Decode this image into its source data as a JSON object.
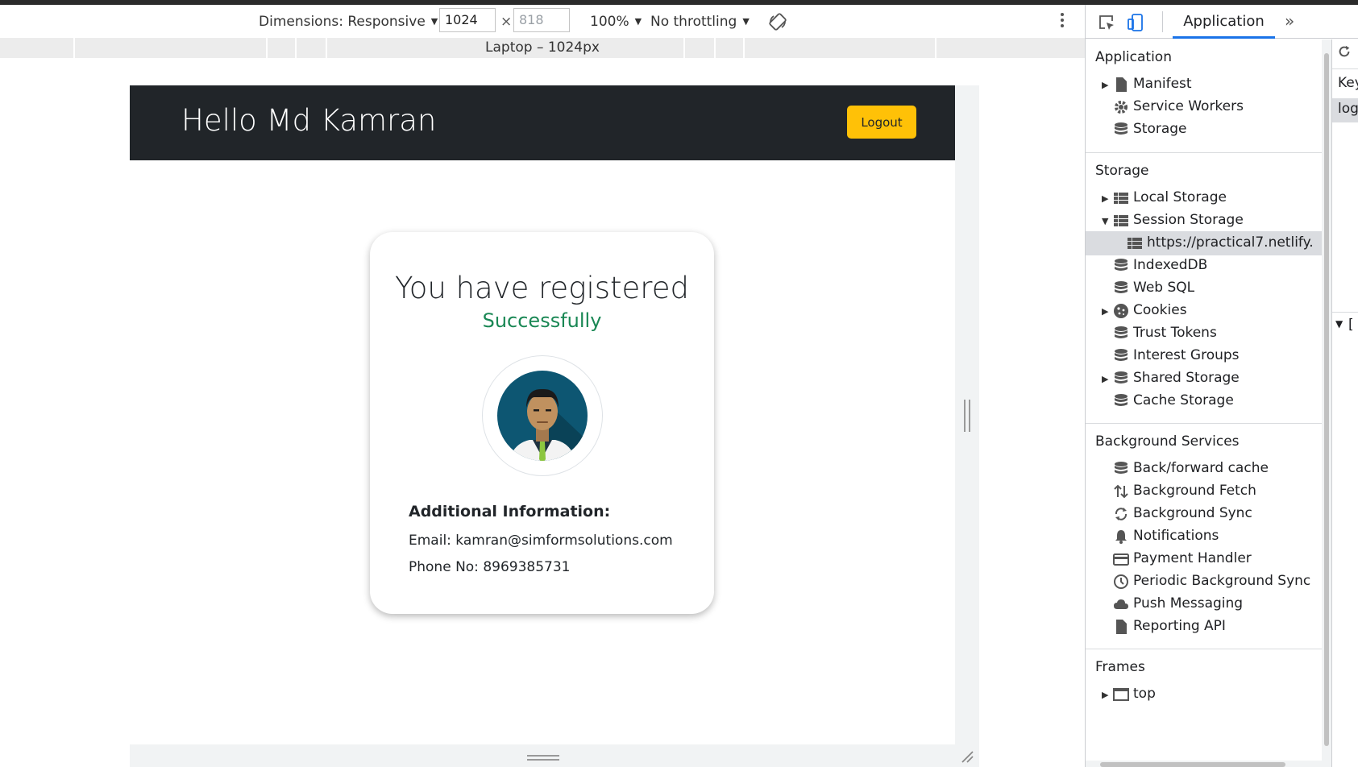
{
  "device_toolbar": {
    "dimensions_label": "Dimensions: Responsive",
    "width_value": "1024",
    "times_sign": "×",
    "height_placeholder": "818",
    "zoom_label": "100%",
    "throttling_label": "No throttling",
    "media_label": "Laptop – 1024px"
  },
  "page": {
    "nav_title": "Hello Md Kamran",
    "logout_label": "Logout",
    "card": {
      "title": "You have registered",
      "subtitle": "Successfully",
      "info_heading": "Additional Information:",
      "email_line": "Email: kamran@simformsolutions.com",
      "phone_line": "Phone No: 8969385731"
    }
  },
  "devtools": {
    "active_tab": "Application",
    "sections": {
      "application": {
        "title": "Application",
        "items": [
          "Manifest",
          "Service Workers",
          "Storage"
        ]
      },
      "storage": {
        "title": "Storage",
        "items": [
          "Local Storage",
          "Session Storage",
          "https://practical7.netlify.",
          "IndexedDB",
          "Web SQL",
          "Cookies",
          "Trust Tokens",
          "Interest Groups",
          "Shared Storage",
          "Cache Storage"
        ]
      },
      "background": {
        "title": "Background Services",
        "items": [
          "Back/forward cache",
          "Background Fetch",
          "Background Sync",
          "Notifications",
          "Payment Handler",
          "Periodic Background Sync",
          "Push Messaging",
          "Reporting API"
        ]
      },
      "frames": {
        "title": "Frames",
        "items": [
          "top"
        ]
      }
    },
    "right_pane": {
      "header": "Key",
      "row": "logi",
      "bracket": "["
    }
  },
  "colors": {
    "navbar": "#212529",
    "logout": "#ffc107",
    "success": "#198754",
    "accent": "#1a73e8"
  }
}
